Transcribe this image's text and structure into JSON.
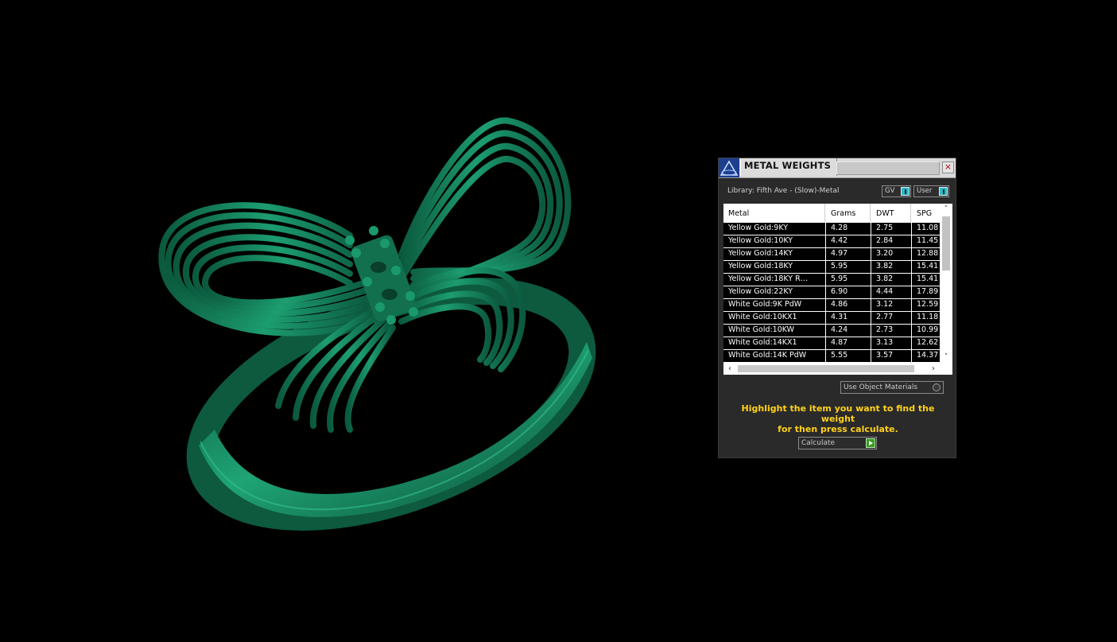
{
  "window": {
    "title": "METAL WEIGHTS",
    "close_label": "×"
  },
  "library": {
    "label": "Library: Fifth Ave - (Slow)-Metal",
    "select_1": "GV",
    "select_2": "User"
  },
  "table": {
    "columns": [
      "Metal",
      "Grams",
      "DWT",
      "SPG"
    ],
    "rows": [
      [
        "Yellow Gold:9KY",
        "4.28",
        "2.75",
        "11.08"
      ],
      [
        "Yellow Gold:10KY",
        "4.42",
        "2.84",
        "11.45"
      ],
      [
        "Yellow Gold:14KY",
        "4.97",
        "3.20",
        "12.88"
      ],
      [
        "Yellow Gold:18KY",
        "5.95",
        "3.82",
        "15.41"
      ],
      [
        "Yellow Gold:18KY R…",
        "5.95",
        "3.82",
        "15.41"
      ],
      [
        "Yellow Gold:22KY",
        "6.90",
        "4.44",
        "17.89"
      ],
      [
        "White Gold:9K PdW",
        "4.86",
        "3.12",
        "12.59"
      ],
      [
        "White Gold:10KX1",
        "4.31",
        "2.77",
        "11.18"
      ],
      [
        "White Gold:10KW",
        "4.24",
        "2.73",
        "10.99"
      ],
      [
        "White Gold:14KX1",
        "4.87",
        "3.13",
        "12.62"
      ],
      [
        "White Gold:14K PdW",
        "5.55",
        "3.57",
        "14.37"
      ]
    ]
  },
  "options": {
    "use_object_materials": "Use Object Materials"
  },
  "hint": {
    "line1": "Highlight the item you want to find the weight",
    "line2": "for then press calculate."
  },
  "actions": {
    "calculate": "Calculate"
  },
  "colors": {
    "ring": "#17875f",
    "hint_text": "#ffd21a",
    "panel_bg": "#2a2a2a"
  }
}
